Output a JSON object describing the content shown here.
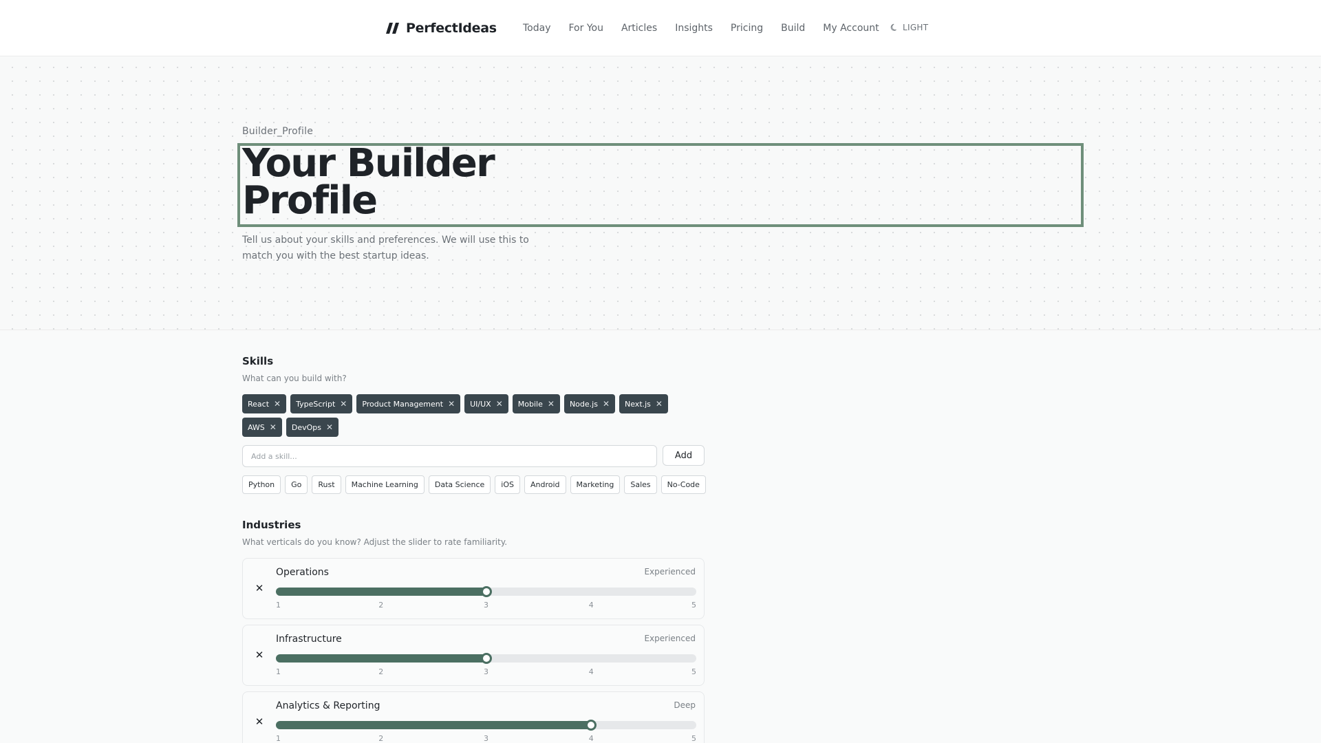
{
  "header": {
    "brand": "PerfectIdeas",
    "nav": [
      "Today",
      "For You",
      "Articles",
      "Insights",
      "Pricing",
      "Build",
      "My Account"
    ],
    "theme_toggle": "LIGHT"
  },
  "hero": {
    "eyebrow": "Builder_Profile",
    "title": "Your Builder Profile",
    "subtitle": "Tell us about your skills and preferences. We will use this to match you with the best startup ideas."
  },
  "skills": {
    "title": "Skills",
    "subtitle": "What can you build with?",
    "selected": [
      "React",
      "TypeScript",
      "Product Management",
      "UI/UX",
      "Mobile",
      "Node.js",
      "Next.js",
      "AWS",
      "DevOps"
    ],
    "input_placeholder": "Add a skill...",
    "add_label": "Add",
    "suggestions": [
      "Python",
      "Go",
      "Rust",
      "Machine Learning",
      "Data Science",
      "iOS",
      "Android",
      "Marketing",
      "Sales",
      "No-Code"
    ]
  },
  "industries": {
    "title": "Industries",
    "subtitle": "What verticals do you know? Adjust the slider to rate familiarity.",
    "scale": [
      "1",
      "2",
      "3",
      "4",
      "5"
    ],
    "scale_max": 5,
    "items": [
      {
        "name": "Operations",
        "level": "Experienced",
        "value": 3
      },
      {
        "name": "Infrastructure",
        "level": "Experienced",
        "value": 3
      },
      {
        "name": "Analytics & Reporting",
        "level": "Deep",
        "value": 4
      }
    ]
  },
  "colors": {
    "accent": "#4b6f62",
    "chip_bg": "#3a464d",
    "focus_outline": "#6f8f7b"
  },
  "icons": {
    "brand_mark": "double-slash-logo",
    "theme": "moon-icon",
    "chip_remove": "close-icon",
    "industry_remove": "close-icon"
  }
}
